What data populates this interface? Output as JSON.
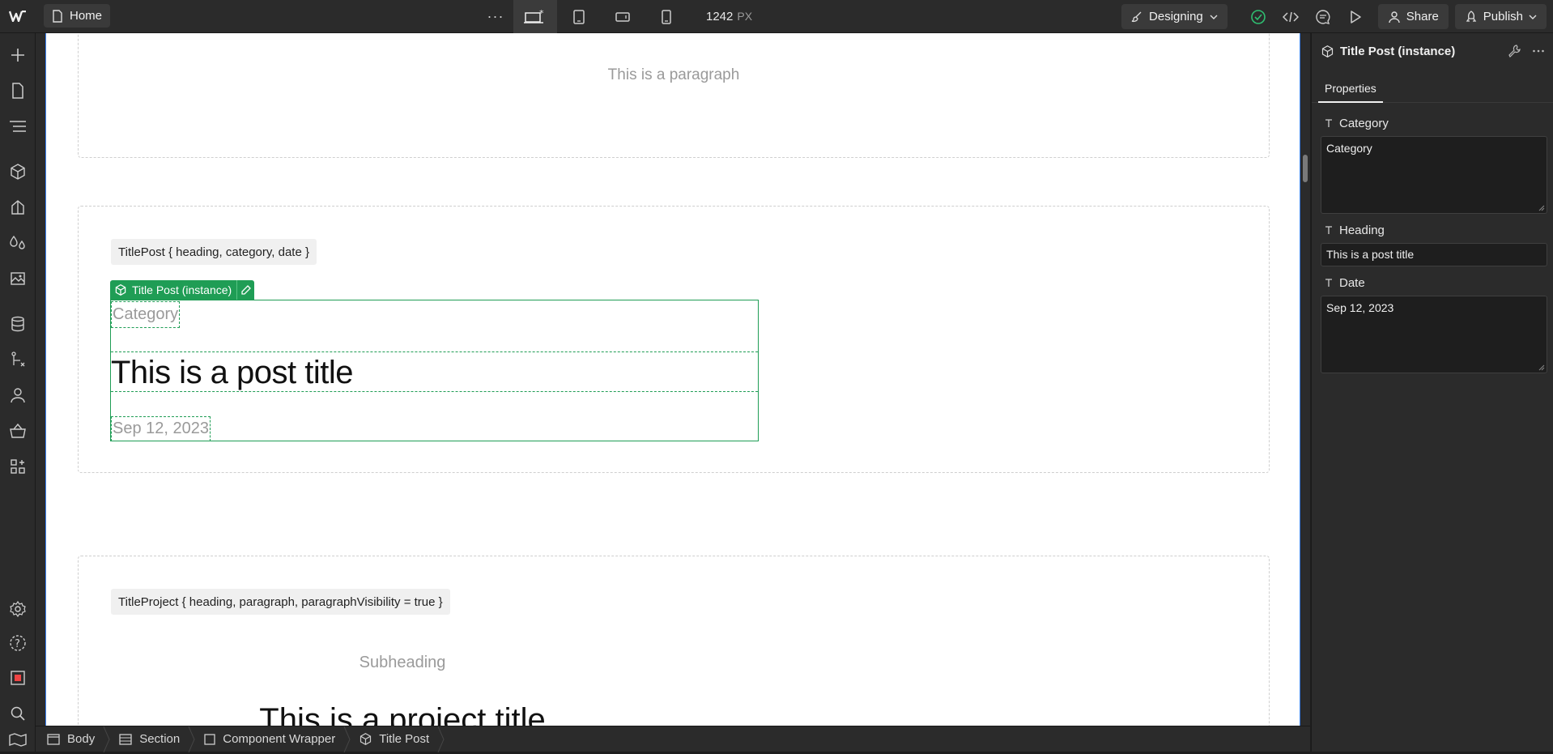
{
  "topbar": {
    "home_label": "Home",
    "width_value": "1242",
    "width_unit": "PX",
    "mode_label": "Designing",
    "share_label": "Share",
    "publish_label": "Publish"
  },
  "canvas": {
    "paragraph_text": "This is a paragraph",
    "titlepost_tag": "TitlePost { heading, category, date }",
    "instance_badge": "Title Post (instance)",
    "category_text": "Category",
    "heading_text": "This is a post title",
    "date_text": "Sep 12, 2023",
    "titleproject_tag": "TitleProject { heading, paragraph, paragraphVisibility = true }",
    "subheading_text": "Subheading",
    "project_title_text": "This is a project title"
  },
  "breadcrumbs": [
    {
      "label": "Body",
      "icon": "body-icon"
    },
    {
      "label": "Section",
      "icon": "section-icon"
    },
    {
      "label": "Component Wrapper",
      "icon": "div-icon"
    },
    {
      "label": "Title Post",
      "icon": "component-icon"
    }
  ],
  "right_panel": {
    "title": "Title Post (instance)",
    "tab": "Properties",
    "props": [
      {
        "label": "Category",
        "value": "Category"
      },
      {
        "label": "Heading",
        "value": "This is a post title"
      },
      {
        "label": "Date",
        "value": "Sep 12, 2023"
      }
    ]
  },
  "colors": {
    "selection_green": "#1f9d55",
    "canvas_border_blue": "#3b82f6",
    "panel_bg": "#2b2b2b"
  }
}
